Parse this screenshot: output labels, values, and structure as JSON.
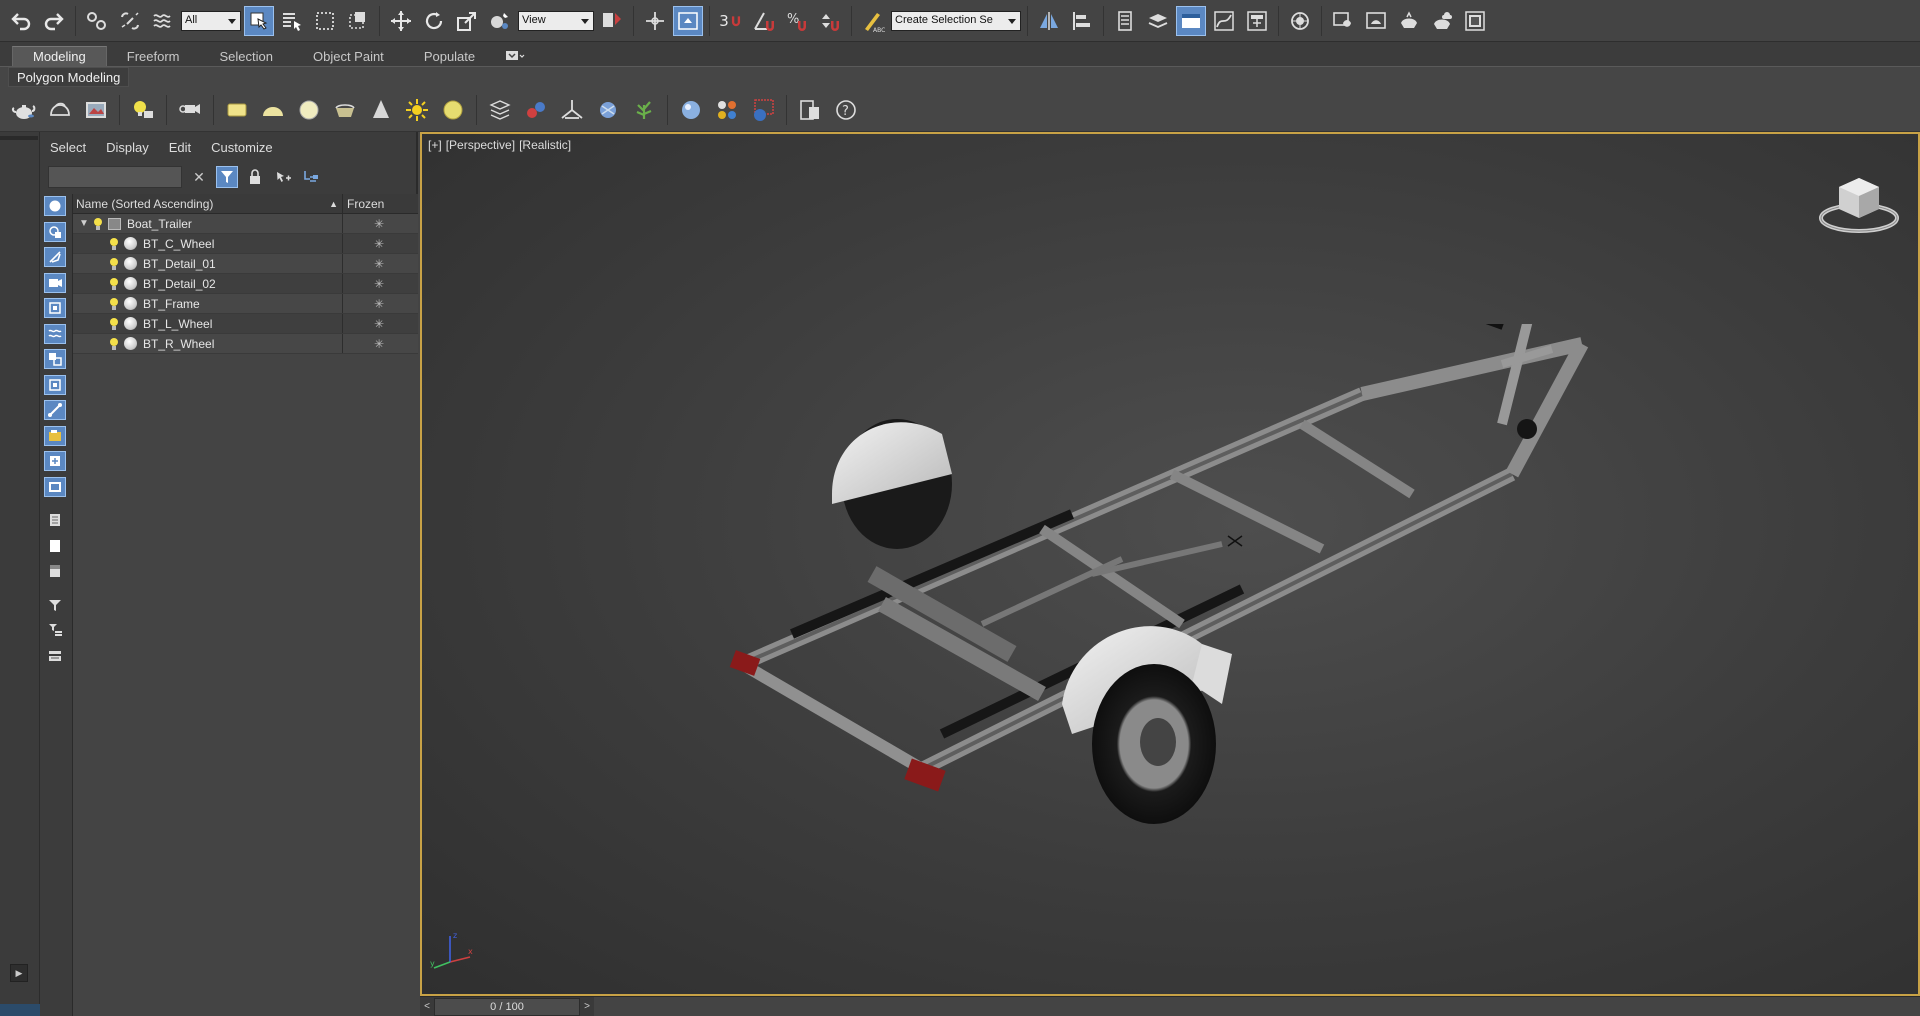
{
  "toolbar": {
    "selection_filter": "All",
    "reference_coord": "View",
    "snap_toggle": "3",
    "named_selection_placeholder": "Create Selection Se"
  },
  "ribbon": {
    "tabs": [
      "Modeling",
      "Freeform",
      "Selection",
      "Object Paint",
      "Populate"
    ],
    "active_tab": "Modeling",
    "panel_label": "Polygon Modeling"
  },
  "scene_explorer": {
    "menu": [
      "Select",
      "Display",
      "Edit",
      "Customize"
    ],
    "search_value": "",
    "columns": {
      "name": "Name (Sorted Ascending)",
      "frozen": "Frozen"
    },
    "rows": [
      {
        "name": "Boat_Trailer",
        "type": "group",
        "frozen": "✳"
      },
      {
        "name": "BT_C_Wheel",
        "type": "object",
        "frozen": "✳"
      },
      {
        "name": "BT_Detail_01",
        "type": "object",
        "frozen": "✳"
      },
      {
        "name": "BT_Detail_02",
        "type": "object",
        "frozen": "✳"
      },
      {
        "name": "BT_Frame",
        "type": "object",
        "frozen": "✳"
      },
      {
        "name": "BT_L_Wheel",
        "type": "object",
        "frozen": "✳"
      },
      {
        "name": "BT_R_Wheel",
        "type": "object",
        "frozen": "✳"
      }
    ]
  },
  "viewport": {
    "label_plus": "[+]",
    "label_view": "[Perspective]",
    "label_shading": "[Realistic]",
    "axis_x": "x",
    "axis_y": "y",
    "axis_z": "z"
  },
  "timeline": {
    "frame": "0 / 100",
    "prev": "<",
    "next": ">"
  },
  "colors": {
    "accent_blue": "#5b88c2",
    "viewport_border": "#c8a246"
  }
}
